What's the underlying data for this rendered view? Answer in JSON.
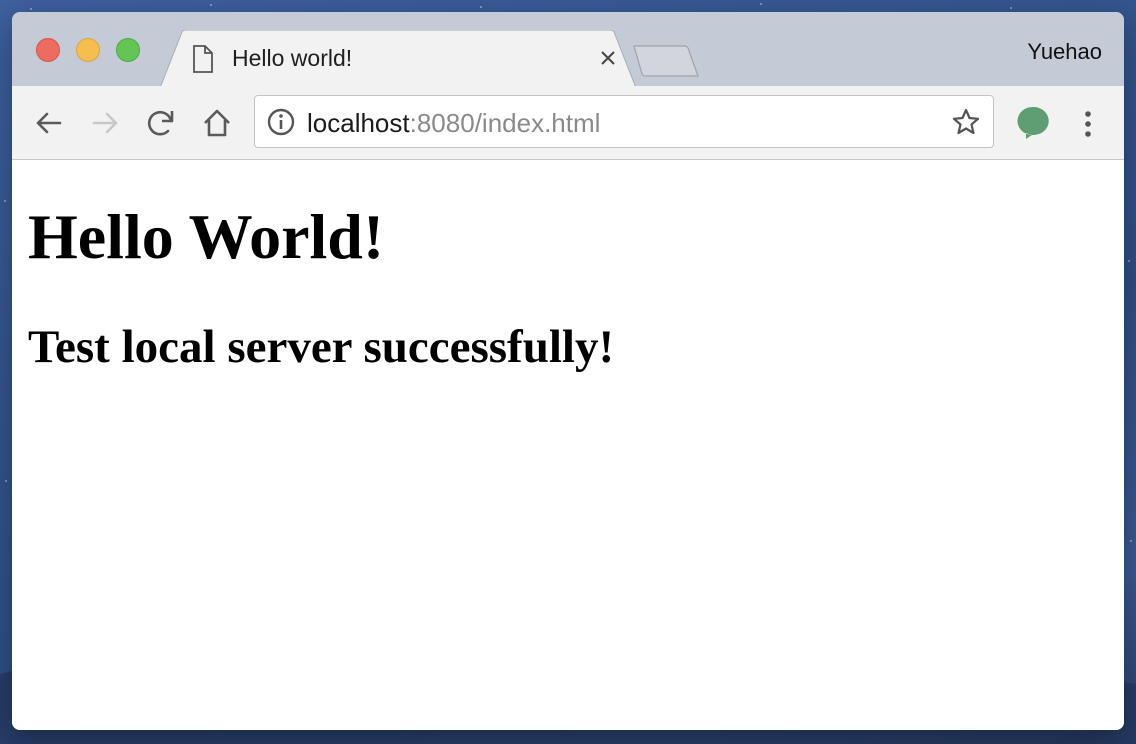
{
  "window": {
    "tab_title": "Hello world!",
    "profile_name": "Yuehao"
  },
  "toolbar": {
    "url_host": "localhost",
    "url_rest": ":8080/index.html"
  },
  "page": {
    "heading": "Hello World!",
    "subheading": "Test local server successfully!"
  },
  "icons": {
    "traffic_lights": [
      "close",
      "minimize",
      "maximize"
    ],
    "tab": [
      "page-icon",
      "close-icon"
    ],
    "toolbar": [
      "back-arrow-icon",
      "forward-arrow-icon",
      "reload-icon",
      "home-icon",
      "info-icon",
      "star-icon",
      "extension-icon",
      "menu-icon"
    ]
  },
  "colors": {
    "traffic_close": "#ed6b5f",
    "traffic_minimize": "#f5bf4f",
    "traffic_maximize": "#62c555",
    "extension": "#5f9e72",
    "titlebar": "#c4cbd7",
    "toolbar": "#f2f2f2"
  }
}
